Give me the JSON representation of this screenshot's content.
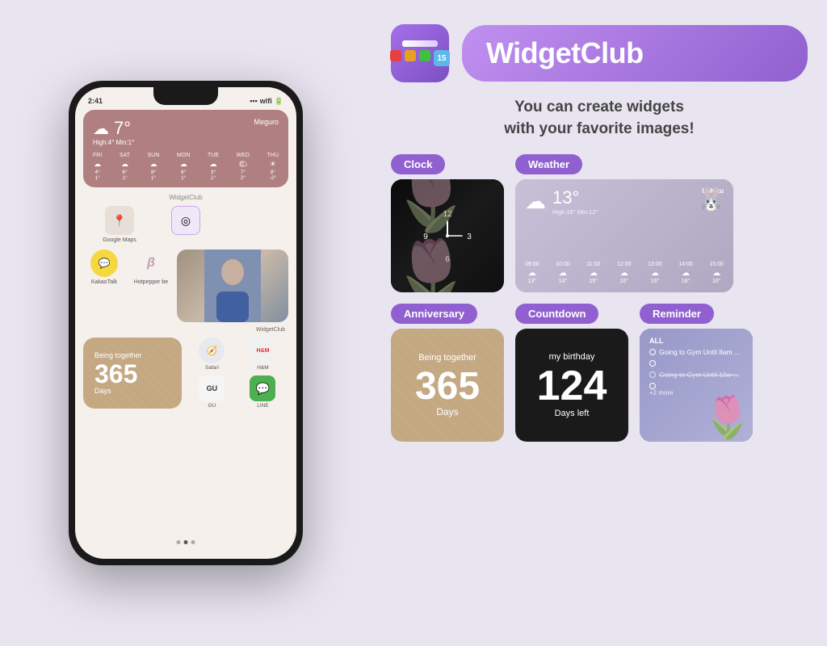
{
  "phone": {
    "time": "2:41",
    "weather_widget": {
      "temp": "7°",
      "location": "Meguro",
      "minmax": "High:4° Min:1°",
      "days": [
        {
          "name": "FRI",
          "icon": "⛅",
          "high": "4°",
          "low": "1°"
        },
        {
          "name": "SAT",
          "icon": "🌤",
          "high": "6°",
          "low": "1°"
        },
        {
          "name": "SUN",
          "icon": "☁",
          "high": "8°",
          "low": "1°"
        },
        {
          "name": "MON",
          "icon": "⛅",
          "high": "6°",
          "low": "1°"
        },
        {
          "name": "TUE",
          "icon": "☁",
          "high": "3°",
          "low": "1°"
        },
        {
          "name": "WED",
          "icon": "🌤",
          "high": "7°",
          "low": "2°"
        },
        {
          "name": "THU",
          "icon": "☀",
          "high": "8°",
          "low": "-2°"
        }
      ]
    },
    "widgetclub_label": "WidgetClub",
    "apps": [
      {
        "name": "Google Maps",
        "bg": "#e8e0d8",
        "icon": "📍"
      },
      {
        "name": "",
        "bg": "#f0e8f0",
        "icon": "◎"
      }
    ],
    "apps2": [
      {
        "name": "KakaoTalk",
        "bg": "#f5d840",
        "icon": "💬"
      },
      {
        "name": "Hotpepper be",
        "bg": "#f5f0f0",
        "icon": "β"
      }
    ],
    "apps3": [
      {
        "name": "Safari",
        "bg": "#e8e8e8",
        "icon": "/"
      },
      {
        "name": "H&M",
        "bg": "#f0f0f0",
        "icon": "H&M"
      },
      {
        "name": "GU",
        "bg": "#f5f5f5",
        "icon": "GU"
      },
      {
        "name": "LINE",
        "bg": "#4caf50",
        "icon": "💬"
      }
    ],
    "widgetclub_label2": "WidgetClub",
    "anniversary": {
      "label": "Being together",
      "number": "365",
      "days": "Days"
    },
    "dots": [
      1,
      2,
      3
    ]
  },
  "right": {
    "app_name": "WidgetClub",
    "badge_number": "15",
    "tagline_line1": "You can create widgets",
    "tagline_line2": "with your favorite images!",
    "categories": {
      "clock": {
        "label": "Clock",
        "clock_numbers": {
          "12": "12",
          "3": "3",
          "6": "6",
          "9": "9"
        }
      },
      "weather": {
        "label": "Weather",
        "temp": "13°",
        "minmax": "High:16° Min:12°",
        "location": "Ushiku",
        "forecast": [
          {
            "time": "09:00",
            "icon": "☁",
            "temp": "13°"
          },
          {
            "time": "10:00",
            "icon": "☁",
            "temp": "14°"
          },
          {
            "time": "11:00",
            "icon": "☁",
            "temp": "15°"
          },
          {
            "time": "12:00",
            "icon": "☁",
            "temp": "16°"
          },
          {
            "time": "13:00",
            "icon": "☁",
            "temp": "16°"
          },
          {
            "time": "14:00",
            "icon": "☁",
            "temp": "16°"
          },
          {
            "time": "15:00",
            "icon": "☁",
            "temp": "16°"
          }
        ]
      },
      "anniversary": {
        "label": "Anniversary",
        "being_together": "Being together",
        "number": "365",
        "days": "Days"
      },
      "countdown": {
        "label": "Countdown",
        "title": "my birthday",
        "number": "124",
        "days_left": "Days left"
      },
      "reminder": {
        "label": "Reminder",
        "all_label": "ALL",
        "items": [
          {
            "text": "Going to Gym Until 8am ...",
            "crossed": false
          },
          {
            "text": "Going to Gym Until 10w ...",
            "crossed": true
          }
        ],
        "more": "+2 more"
      }
    }
  }
}
